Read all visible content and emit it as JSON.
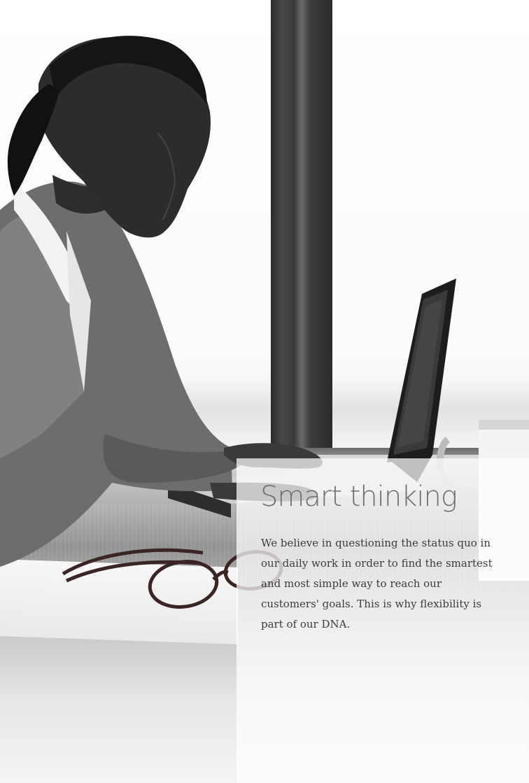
{
  "panel": {
    "headline": "Smart thinking",
    "body": "We believe in questioning the status quo in our daily work in order to find the smartest and most simple way to reach our customers' goals. This is why flexibility is part of our DNA."
  },
  "photo": {
    "subject": "woman-typing-on-laptop",
    "palette": {
      "shadow": "#2b2b2b",
      "highlight": "#ffffff",
      "text": "#3c3c3c",
      "headline": "#6f6f6f"
    }
  }
}
